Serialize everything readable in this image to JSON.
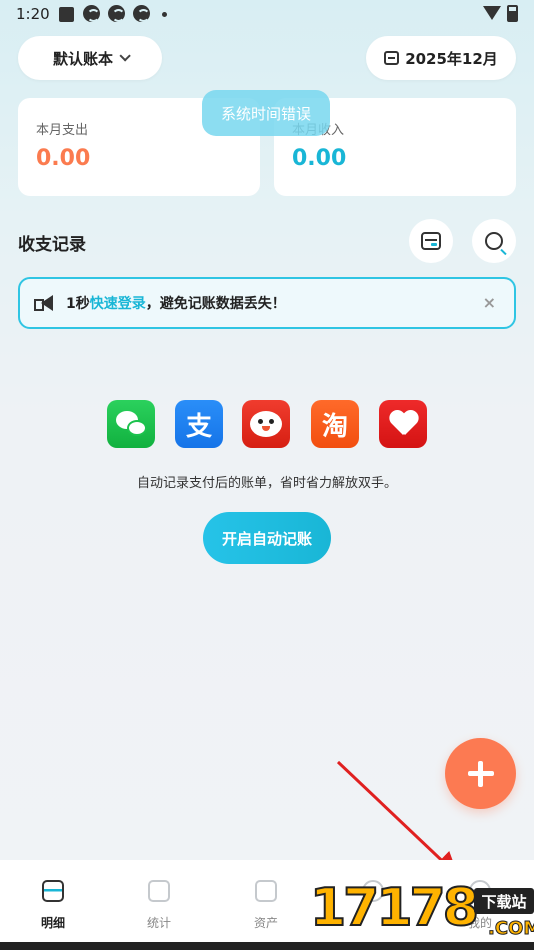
{
  "status_bar": {
    "time": "1:20"
  },
  "header": {
    "ledger_label": "默认账本",
    "month_label": "2025年12月"
  },
  "summary": {
    "expense_label": "本月支出",
    "expense_value": "0.00",
    "income_label": "本月收入",
    "income_value": "0.00"
  },
  "toast": "系统时间错误",
  "records": {
    "title": "收支记录"
  },
  "banner": {
    "prefix": "1秒",
    "link": "快速登录",
    "suffix": "，避免记账数据丢失！",
    "close": "×"
  },
  "apps": {
    "alipay_glyph": "支",
    "taobao_glyph": "淘"
  },
  "auto": {
    "description": "自动记录支付后的账单，省时省力解放双手。",
    "button": "开启自动记账"
  },
  "tabs": [
    {
      "label": "明细"
    },
    {
      "label": "统计"
    },
    {
      "label": "资产"
    },
    {
      "label": ""
    },
    {
      "label": "我的"
    }
  ],
  "watermark": {
    "number": "17178",
    "tag": "下载站",
    "domain": ".COM"
  },
  "colors": {
    "accent": "#19b6d6",
    "expense": "#fb7b4f",
    "fab": "#fc7a52",
    "annotation_arrow": "#e02020"
  }
}
